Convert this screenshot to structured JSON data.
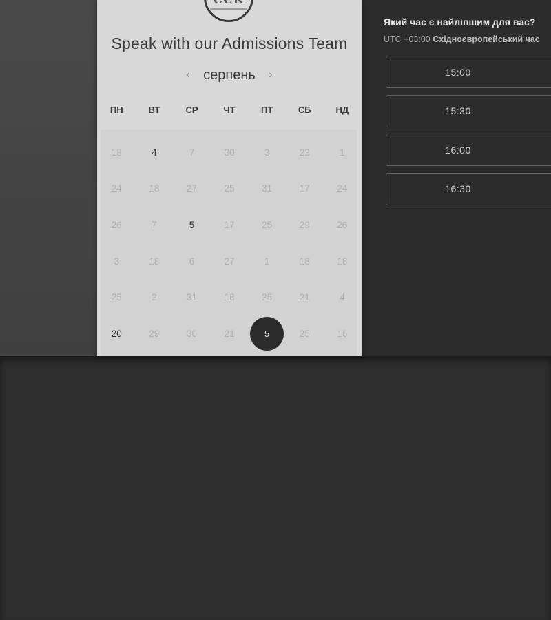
{
  "scheduler": {
    "logo_text": "CCK",
    "title": "Speak with our Admissions Team",
    "month": "серпень",
    "prev_icon": "‹",
    "next_icon": "›",
    "weekdays": [
      "ПН",
      "ВТ",
      "СР",
      "ЧТ",
      "ПТ",
      "СБ",
      "НД"
    ],
    "weeks": [
      [
        "18",
        "4",
        "7",
        "30",
        "3",
        "23",
        "1"
      ],
      [
        "24",
        "18",
        "27",
        "25",
        "31",
        "17",
        "24"
      ],
      [
        "26",
        "7",
        "5",
        "17",
        "25",
        "29",
        "26"
      ],
      [
        "3",
        "18",
        "6",
        "27",
        "1",
        "18",
        "18"
      ],
      [
        "25",
        "2",
        "31",
        "18",
        "25",
        "21",
        "4"
      ],
      [
        "20",
        "29",
        "30",
        "21",
        "5",
        "25",
        "16"
      ]
    ],
    "active_days": [
      [
        0,
        1
      ],
      [
        2,
        2
      ],
      [
        5,
        0
      ]
    ],
    "selected_day": [
      5,
      4
    ]
  },
  "times": {
    "question": "Який час є найліпшим для вас?",
    "timezone_prefix": "UTC +03:00",
    "timezone_name": "Східноєвропейський час",
    "slots": [
      "15:00",
      "15:30",
      "16:00",
      "16:30"
    ]
  }
}
